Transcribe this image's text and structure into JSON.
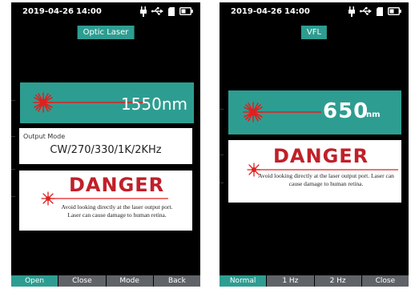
{
  "screen_a": {
    "status": {
      "date": "2019-04-26",
      "time": "14:00"
    },
    "title": "Optic Laser",
    "wavelength": "1550nm",
    "output_mode": {
      "label": "Output Mode",
      "value": "CW/270/330/1K/2KHz"
    },
    "danger": {
      "title": "DANGER",
      "message": "Avoid looking directly at the laser output port. Laser can cause damage to human retina."
    },
    "softkeys": [
      {
        "label": "Open",
        "active": true
      },
      {
        "label": "Close"
      },
      {
        "label": "Mode"
      },
      {
        "label": "Back"
      }
    ]
  },
  "screen_b": {
    "status": {
      "date": "2019-04-26",
      "time": "14:00"
    },
    "title": "VFL",
    "wavelength_value": "650",
    "wavelength_unit": "nm",
    "danger": {
      "title": "DANGER",
      "message": "Avoid looking directly at the laser output port. Laser can cause damage to human retina."
    },
    "softkeys": [
      {
        "label": "Normal",
        "active": true
      },
      {
        "label": "1 Hz"
      },
      {
        "label": "2 Hz"
      },
      {
        "label": "Close"
      }
    ]
  },
  "colors": {
    "accent": "#2e9d91",
    "danger": "#c0202a",
    "laser": "#e0201f",
    "softkey": "#606368"
  },
  "icons": [
    "power-plug-icon",
    "usb-icon",
    "sd-card-icon",
    "battery-icon",
    "laser-icon"
  ]
}
